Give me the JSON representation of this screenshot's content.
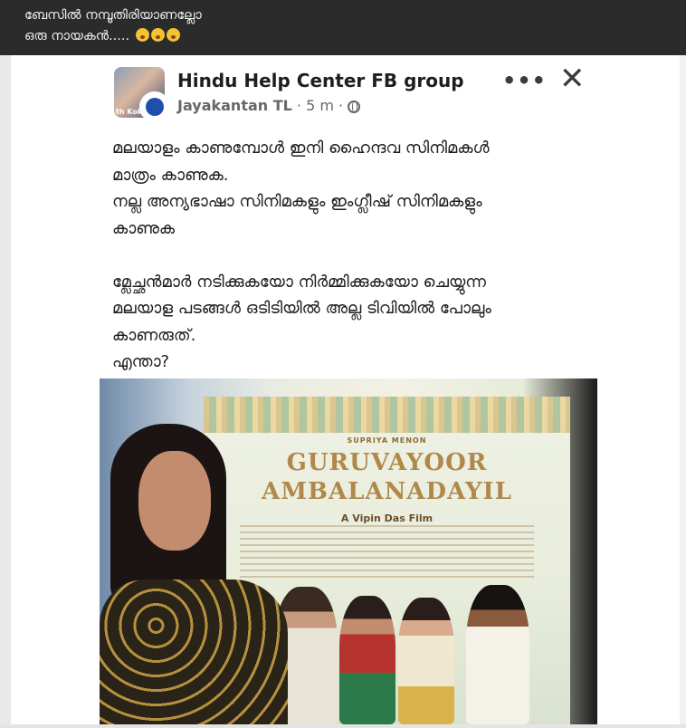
{
  "top_caption": {
    "line1": "ബേസിൽ നമ്പൂതിരിയാണല്ലോ",
    "line2": "ഒരു നായകൻ....."
  },
  "post": {
    "group_name": "Hindu Help Center FB group",
    "author": "Jayakantan TL",
    "time": "5 m",
    "more_icon": "more-options-icon",
    "close_icon": "close-icon",
    "privacy_icon": "globe-icon",
    "avatar_label": "th Kok",
    "text": "മലയാളം കാണുമ്പോൾ ഇനി ഹൈന്ദവ സിനിമകൾ\nമാത്രം കാണുക.\nനല്ല അന്യഭാഷാ സിനിമകളും ഇംഗ്ലീഷ് സിനിമകളും\nകാണുക\n\nമ്ലേച്ഛൻമാർ നടിക്കുകയോ നിർമ്മിക്കുകയോ ചെയ്യുന്ന\nമലയാള പടങ്ങൾ ഒടിടിയിൽ അല്ല ടിവിയിൽ പോലും\nകാണരുത്.\nഎന്താ?"
  },
  "poster": {
    "presenter": "SUPRIYA MENON",
    "title_line1": "GURUVAYOOR",
    "title_line2": "AMBALANADAYIL",
    "director": "A Vipin Das Film"
  },
  "colors": {
    "top_bar": "#2b2b2b",
    "card_bg": "#ffffff",
    "meta_text": "#65676b"
  }
}
